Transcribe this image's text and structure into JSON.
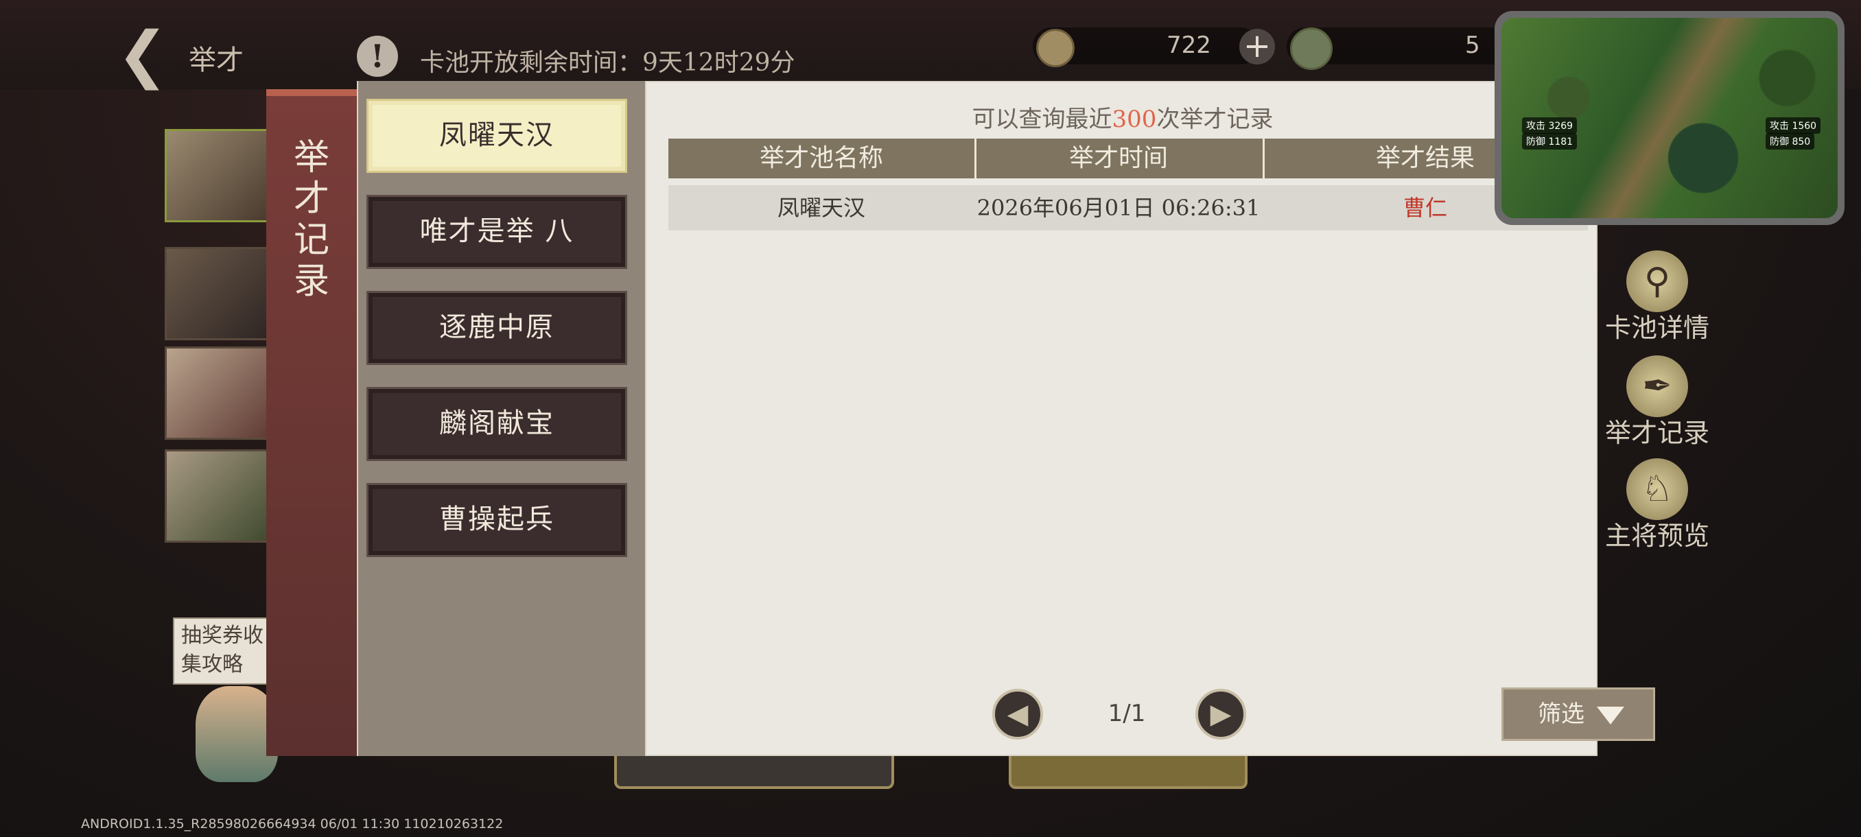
{
  "header": {
    "title": "举才",
    "timer_text": "卡池开放剩余时间：9天12时29分",
    "coin_value": "722",
    "jade_value": "5"
  },
  "sidebar_left": {
    "voucher_text": "抽奖券收集攻略"
  },
  "dialog": {
    "title": "举才记录",
    "tabs": [
      {
        "label": "凤曜天汉",
        "active": true
      },
      {
        "label": "唯才是举 八",
        "active": false
      },
      {
        "label": "逐鹿中原",
        "active": false
      },
      {
        "label": "麟阁献宝",
        "active": false
      },
      {
        "label": "曹操起兵",
        "active": false
      }
    ],
    "hint_prefix": "可以查询最近",
    "hint_number": "300",
    "hint_suffix": "次举才记录",
    "columns": [
      "举才池名称",
      "举才时间",
      "举才结果"
    ],
    "rows": [
      {
        "pool": "凤曜天汉",
        "time": "2026年06月01日 06:26:31",
        "result": "曹仁"
      }
    ],
    "page": "1/1",
    "filter_label": "筛选"
  },
  "side_actions": [
    {
      "label": "卡池详情",
      "icon": "magnifier-icon"
    },
    {
      "label": "举才记录",
      "icon": "brush-icon"
    },
    {
      "label": "主将预览",
      "icon": "general-icon"
    }
  ],
  "minimap": {
    "stats": [
      "攻击 3269",
      "防御 1181",
      "攻击 1560",
      "防御 850"
    ]
  },
  "build_info": "ANDROID1.1.35_R28598026664934 06/01 11:30 110210263122",
  "colors": {
    "accent_red": "#c0392b",
    "hint_number": "#e0644a",
    "tab_active": "#f4efc5"
  }
}
